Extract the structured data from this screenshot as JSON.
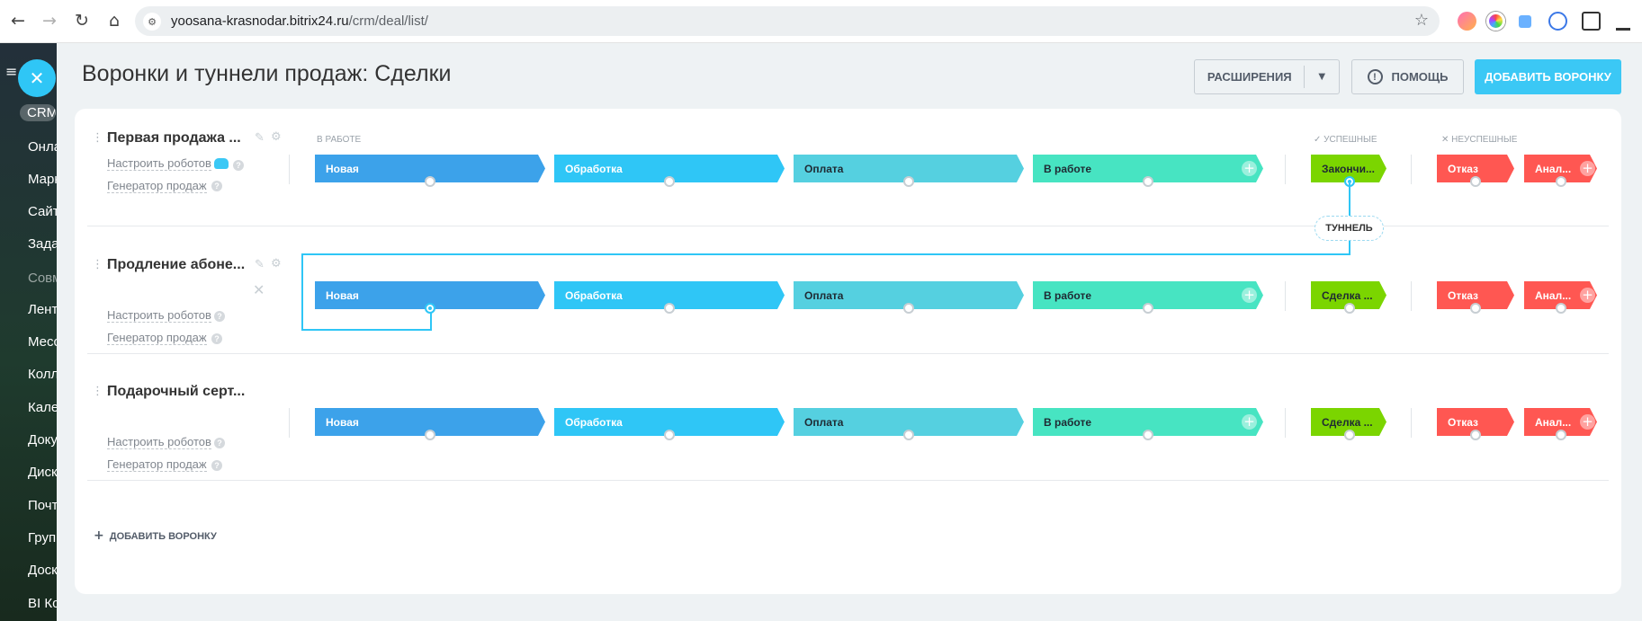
{
  "browser": {
    "url_host": "yoosana-krasnodar.bitrix24.ru",
    "url_path": "/crm/deal/list/"
  },
  "sidebar": {
    "items": [
      {
        "label": "CRM",
        "active": true
      },
      {
        "label": "Онлайн"
      },
      {
        "label": "Маркетинг"
      },
      {
        "label": "Сайты"
      },
      {
        "label": "Задачи"
      },
      {
        "label": "Совместная",
        "dim": true
      },
      {
        "label": "Лента"
      },
      {
        "label": "Мессенджер"
      },
      {
        "label": "Коллеги"
      },
      {
        "label": "Календарь"
      },
      {
        "label": "Документы"
      },
      {
        "label": "Диск"
      },
      {
        "label": "Почта"
      },
      {
        "label": "Группы"
      },
      {
        "label": "Доска"
      },
      {
        "label": "BI Конструктор"
      }
    ]
  },
  "header": {
    "title": "Воронки и туннели продаж: Сделки",
    "extensions_label": "РАСШИРЕНИЯ",
    "help_label": "ПОМОЩЬ",
    "add_funnel_label": "ДОБАВИТЬ ВОРОНКУ"
  },
  "columns": {
    "in_work": "В РАБОТЕ",
    "success": "✓ УСПЕШНЫЕ",
    "failed": "✕ НЕУСПЕШНЫЕ"
  },
  "funnels": [
    {
      "name": "Первая продажа ...",
      "robots_link": "Настроить роботов",
      "generator_link": "Генератор продаж",
      "stages": [
        "Новая",
        "Обработка",
        "Оплата",
        "В работе"
      ],
      "success_stage": "Закончи...",
      "fail_stages": [
        "Отказ",
        "Анал..."
      ]
    },
    {
      "name": "Продление абоне...",
      "robots_link": "Настроить роботов",
      "generator_link": "Генератор продаж",
      "stages": [
        "Новая",
        "Обработка",
        "Оплата",
        "В работе"
      ],
      "success_stage": "Сделка ...",
      "fail_stages": [
        "Отказ",
        "Анал..."
      ]
    },
    {
      "name": "Подарочный серт...",
      "robots_link": "Настроить роботов",
      "generator_link": "Генератор продаж",
      "stages": [
        "Новая",
        "Обработка",
        "Оплата",
        "В работе"
      ],
      "success_stage": "Сделка ...",
      "fail_stages": [
        "Отказ",
        "Анал..."
      ]
    }
  ],
  "tunnel": {
    "label": "ТУННЕЛЬ"
  },
  "footer": {
    "add_funnel": "ДОБАВИТЬ ВОРОНКУ"
  },
  "colors": {
    "stage_new": "#3ca2ea",
    "stage_processing": "#2fc6f6",
    "stage_payment": "#55d0e0",
    "stage_in_work": "#47e4c2",
    "stage_success": "#7bd500",
    "stage_fail": "#ff5752",
    "accent": "#3bc8f5"
  }
}
